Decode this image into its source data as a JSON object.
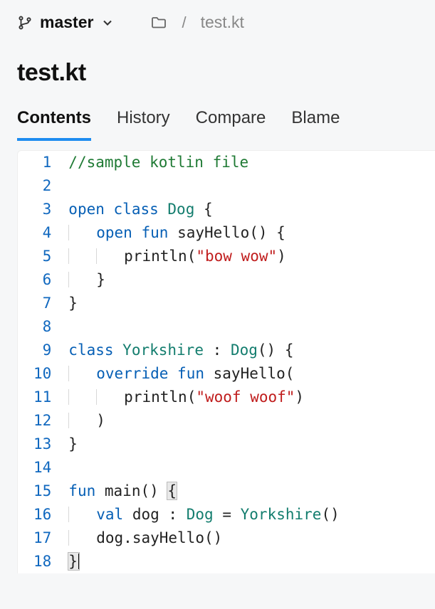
{
  "branch": {
    "name": "master"
  },
  "breadcrumb": {
    "file": "test.kt"
  },
  "title": "test.kt",
  "tabs": {
    "contents": "Contents",
    "history": "History",
    "compare": "Compare",
    "blame": "Blame"
  },
  "code": {
    "line_count": 18,
    "raw": "//sample kotlin file\n\nopen class Dog {\n    open fun sayHello() {\n        println(\"bow wow\")\n    }\n}\n\nclass Yorkshire : Dog() {\n    override fun sayHello(\n        println(\"woof woof\")\n    )\n}\n\nfun main() {\n    val dog : Dog = Yorkshire()\n    dog.sayHello()\n}",
    "tokens": [
      [
        {
          "t": "comment",
          "v": "//sample kotlin file"
        }
      ],
      [],
      [
        {
          "t": "keyword",
          "v": "open"
        },
        {
          "t": "sp",
          "v": " "
        },
        {
          "t": "keyword",
          "v": "class"
        },
        {
          "t": "sp",
          "v": " "
        },
        {
          "t": "type",
          "v": "Dog"
        },
        {
          "t": "sp",
          "v": " "
        },
        {
          "t": "punc",
          "v": "{"
        }
      ],
      [
        {
          "t": "indent",
          "n": 1
        },
        {
          "t": "keyword",
          "v": "open"
        },
        {
          "t": "sp",
          "v": " "
        },
        {
          "t": "keyword",
          "v": "fun"
        },
        {
          "t": "sp",
          "v": " "
        },
        {
          "t": "ident",
          "v": "sayHello"
        },
        {
          "t": "punc",
          "v": "()"
        },
        {
          "t": "sp",
          "v": " "
        },
        {
          "t": "punc",
          "v": "{"
        }
      ],
      [
        {
          "t": "indent",
          "n": 2
        },
        {
          "t": "ident",
          "v": "println"
        },
        {
          "t": "punc",
          "v": "("
        },
        {
          "t": "string",
          "v": "\"bow wow\""
        },
        {
          "t": "punc",
          "v": ")"
        }
      ],
      [
        {
          "t": "indent",
          "n": 1
        },
        {
          "t": "punc",
          "v": "}"
        }
      ],
      [
        {
          "t": "punc",
          "v": "}"
        }
      ],
      [],
      [
        {
          "t": "keyword",
          "v": "class"
        },
        {
          "t": "sp",
          "v": " "
        },
        {
          "t": "type",
          "v": "Yorkshire"
        },
        {
          "t": "sp",
          "v": " "
        },
        {
          "t": "punc",
          "v": ":"
        },
        {
          "t": "sp",
          "v": " "
        },
        {
          "t": "type",
          "v": "Dog"
        },
        {
          "t": "punc",
          "v": "()"
        },
        {
          "t": "sp",
          "v": " "
        },
        {
          "t": "punc",
          "v": "{"
        }
      ],
      [
        {
          "t": "indent",
          "n": 1
        },
        {
          "t": "keyword",
          "v": "override"
        },
        {
          "t": "sp",
          "v": " "
        },
        {
          "t": "keyword",
          "v": "fun"
        },
        {
          "t": "sp",
          "v": " "
        },
        {
          "t": "ident",
          "v": "sayHello"
        },
        {
          "t": "punc",
          "v": "("
        }
      ],
      [
        {
          "t": "indent",
          "n": 2
        },
        {
          "t": "ident",
          "v": "println"
        },
        {
          "t": "punc",
          "v": "("
        },
        {
          "t": "string",
          "v": "\"woof woof\""
        },
        {
          "t": "punc",
          "v": ")"
        }
      ],
      [
        {
          "t": "indent",
          "n": 1
        },
        {
          "t": "punc",
          "v": ")"
        }
      ],
      [
        {
          "t": "punc",
          "v": "}"
        }
      ],
      [],
      [
        {
          "t": "keyword",
          "v": "fun"
        },
        {
          "t": "sp",
          "v": " "
        },
        {
          "t": "ident",
          "v": "main"
        },
        {
          "t": "punc",
          "v": "()"
        },
        {
          "t": "sp",
          "v": " "
        },
        {
          "t": "brace1",
          "v": "{"
        }
      ],
      [
        {
          "t": "indent",
          "n": 1
        },
        {
          "t": "keyword",
          "v": "val"
        },
        {
          "t": "sp",
          "v": " "
        },
        {
          "t": "ident",
          "v": "dog"
        },
        {
          "t": "sp",
          "v": " "
        },
        {
          "t": "punc",
          "v": ":"
        },
        {
          "t": "sp",
          "v": " "
        },
        {
          "t": "type",
          "v": "Dog"
        },
        {
          "t": "sp",
          "v": " "
        },
        {
          "t": "punc",
          "v": "="
        },
        {
          "t": "sp",
          "v": " "
        },
        {
          "t": "type",
          "v": "Yorkshire"
        },
        {
          "t": "punc",
          "v": "()"
        }
      ],
      [
        {
          "t": "indent",
          "n": 1
        },
        {
          "t": "ident",
          "v": "dog"
        },
        {
          "t": "punc",
          "v": "."
        },
        {
          "t": "ident",
          "v": "sayHello"
        },
        {
          "t": "punc",
          "v": "()"
        }
      ],
      [
        {
          "t": "brace2",
          "v": "}"
        }
      ]
    ]
  }
}
